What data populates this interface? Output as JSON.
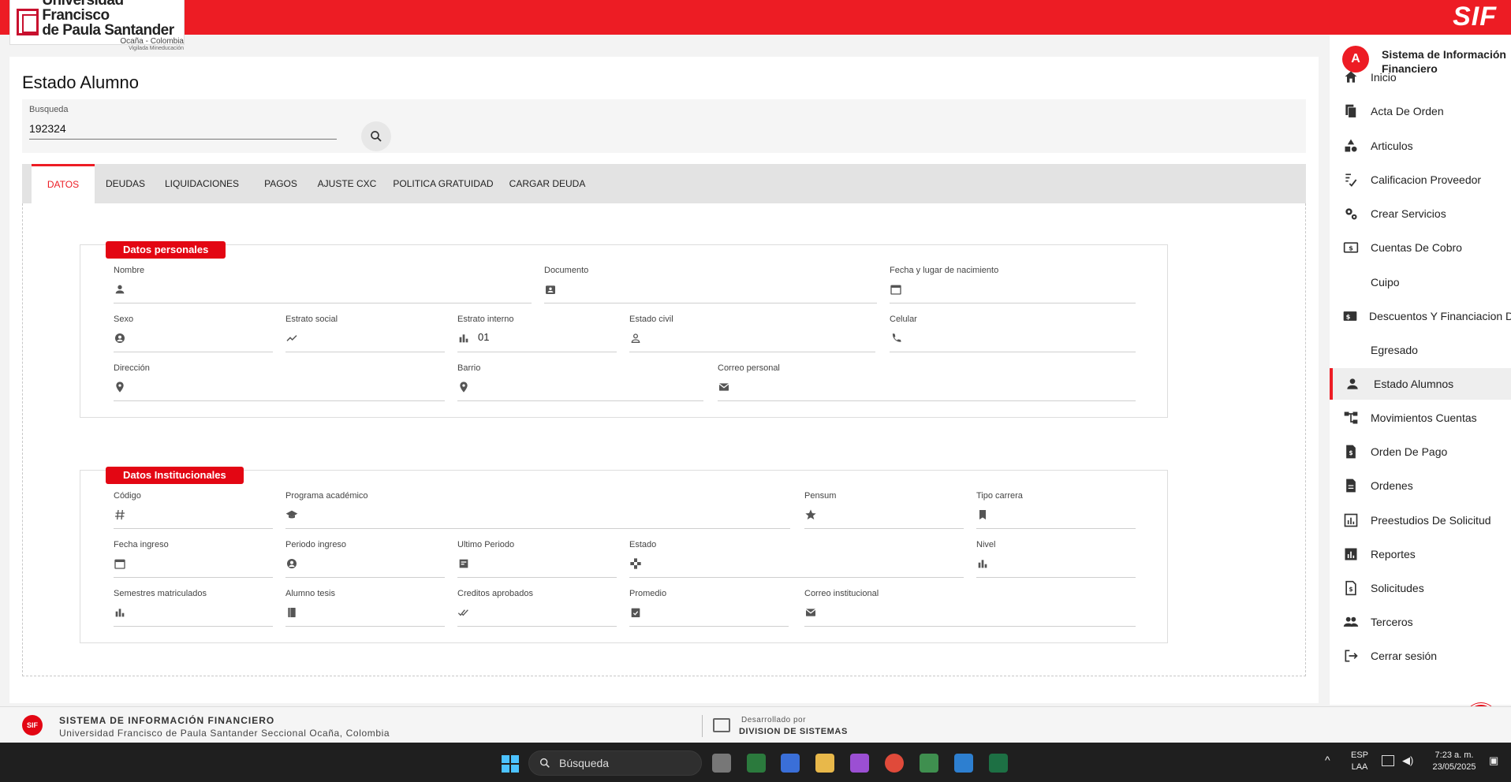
{
  "header": {
    "logo_line1": "Universidad Francisco",
    "logo_line2": "de Paula Santander",
    "logo_line3": "Ocaña - Colombia",
    "logo_line4": "Vigilada Mineducación",
    "brand": "SIF"
  },
  "page": {
    "title": "Estado Alumno",
    "search_label": "Busqueda",
    "search_value": "192324"
  },
  "tabs": [
    "DATOS",
    "DEUDAS",
    "LIQUIDACIONES",
    "PAGOS",
    "AJUSTE CXC",
    "POLITICA GRATUIDAD",
    "CARGAR DEUDA"
  ],
  "personal": {
    "title": "Datos personales",
    "fields": {
      "nombre": {
        "label": "Nombre",
        "value": ""
      },
      "documento": {
        "label": "Documento",
        "value": ""
      },
      "nacimiento": {
        "label": "Fecha y lugar de nacimiento",
        "value": ""
      },
      "sexo": {
        "label": "Sexo",
        "value": ""
      },
      "estrato_social": {
        "label": "Estrato social",
        "value": ""
      },
      "estrato_interno": {
        "label": "Estrato interno",
        "value": "01"
      },
      "estado_civil": {
        "label": "Estado civil",
        "value": ""
      },
      "celular": {
        "label": "Celular",
        "value": ""
      },
      "direccion": {
        "label": "Dirección",
        "value": ""
      },
      "barrio": {
        "label": "Barrio",
        "value": ""
      },
      "correo_personal": {
        "label": "Correo personal",
        "value": ""
      }
    }
  },
  "institucional": {
    "title": "Datos Institucionales",
    "fields": {
      "codigo": {
        "label": "Código",
        "value": ""
      },
      "programa": {
        "label": "Programa académico",
        "value": ""
      },
      "pensum": {
        "label": "Pensum",
        "value": ""
      },
      "tipo_carrera": {
        "label": "Tipo carrera",
        "value": ""
      },
      "fecha_ingreso": {
        "label": "Fecha ingreso",
        "value": ""
      },
      "periodo_ingreso": {
        "label": "Periodo ingreso",
        "value": ""
      },
      "ultimo_periodo": {
        "label": "Ultimo Periodo",
        "value": ""
      },
      "estado": {
        "label": "Estado",
        "value": ""
      },
      "nivel": {
        "label": "Nivel",
        "value": ""
      },
      "semestres": {
        "label": "Semestres matriculados",
        "value": ""
      },
      "tesis": {
        "label": "Alumno tesis",
        "value": ""
      },
      "creditos": {
        "label": "Creditos aprobados",
        "value": ""
      },
      "promedio": {
        "label": "Promedio",
        "value": ""
      },
      "correo_inst": {
        "label": "Correo institucional",
        "value": ""
      }
    }
  },
  "sidebar": {
    "avatar": "A",
    "title": "Sistema de Información Financiero",
    "items": [
      {
        "label": "Inicio",
        "icon": "home-icon"
      },
      {
        "label": "Acta De Orden",
        "icon": "document-copy-icon"
      },
      {
        "label": "Articulos",
        "icon": "shapes-icon"
      },
      {
        "label": "Calificacion Proveedor",
        "icon": "rating-check-icon"
      },
      {
        "label": "Crear Servicios",
        "icon": "gears-icon"
      },
      {
        "label": "Cuentas De Cobro",
        "icon": "money-icon"
      },
      {
        "label": "Cuipo",
        "icon": ""
      },
      {
        "label": "Descuentos Y Financiacion De",
        "icon": "discount-money-icon"
      },
      {
        "label": "Egresado",
        "icon": ""
      },
      {
        "label": "Estado Alumnos",
        "icon": "person-icon"
      },
      {
        "label": "Movimientos Cuentas",
        "icon": "account-tree-icon"
      },
      {
        "label": "Orden De Pago",
        "icon": "dollar-file-icon"
      },
      {
        "label": "Ordenes",
        "icon": "file-icon"
      },
      {
        "label": "Preestudios De Solicitud",
        "icon": "analytics-icon"
      },
      {
        "label": "Reportes",
        "icon": "bar-chart-icon"
      },
      {
        "label": "Solicitudes",
        "icon": "dollar-doc-icon"
      },
      {
        "label": "Terceros",
        "icon": "group-icon"
      },
      {
        "label": "Cerrar sesión",
        "icon": "logout-icon"
      }
    ]
  },
  "footer": {
    "logo": "SIF",
    "title": "SISTEMA DE INFORMACIÓN FINANCIERO",
    "subtitle": "Universidad Francisco de Paula Santander Seccional Ocaña, Colombia",
    "dev_line1": "Desarrollado por",
    "dev_line2": "DIVISION DE SISTEMAS"
  },
  "taskbar": {
    "search": "Búsqueda",
    "lang1": "ESP",
    "lang2": "LAA",
    "time": "7:23 a. m.",
    "date": "23/05/2025"
  },
  "colors": {
    "accent": "#ed1c24",
    "tag": "#e30613"
  }
}
